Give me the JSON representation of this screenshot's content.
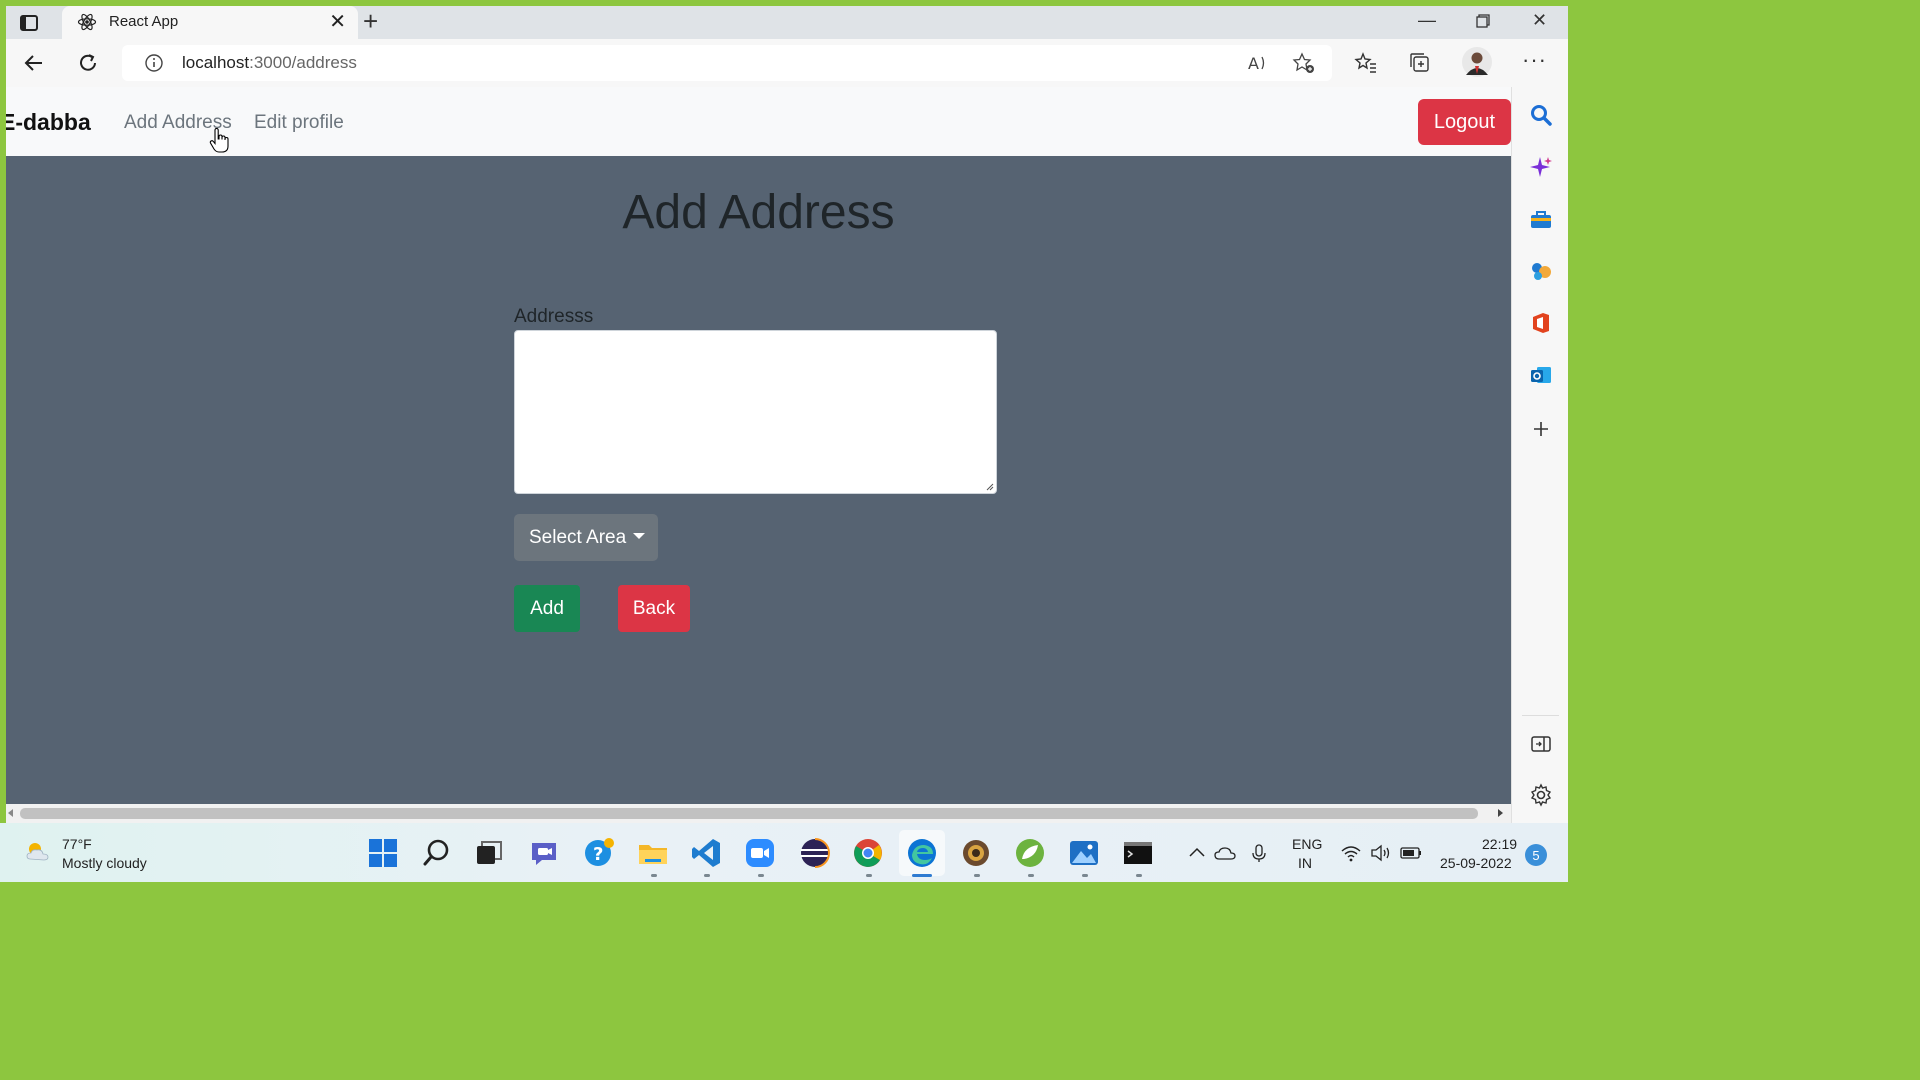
{
  "browser": {
    "tab_title": "React App",
    "url_host": "localhost",
    "url_path": ":3000/address"
  },
  "app": {
    "brand": "E-dabba",
    "nav_links": [
      "Add Address",
      "Edit profile"
    ],
    "logout_label": "Logout"
  },
  "form": {
    "heading": "Add Address",
    "address_label": "Addresss",
    "address_value": "",
    "select_area_label": "Select Area",
    "add_label": "Add",
    "back_label": "Back"
  },
  "taskbar": {
    "weather_temp": "77°F",
    "weather_desc": "Mostly cloudy",
    "lang_line1": "ENG",
    "lang_line2": "IN",
    "time": "22:19",
    "date": "25-09-2022",
    "notification_count": "5"
  },
  "colors": {
    "page_bg": "#566372",
    "logout_red": "#dc3545",
    "add_green": "#198754",
    "select_gray": "#6c757d"
  }
}
